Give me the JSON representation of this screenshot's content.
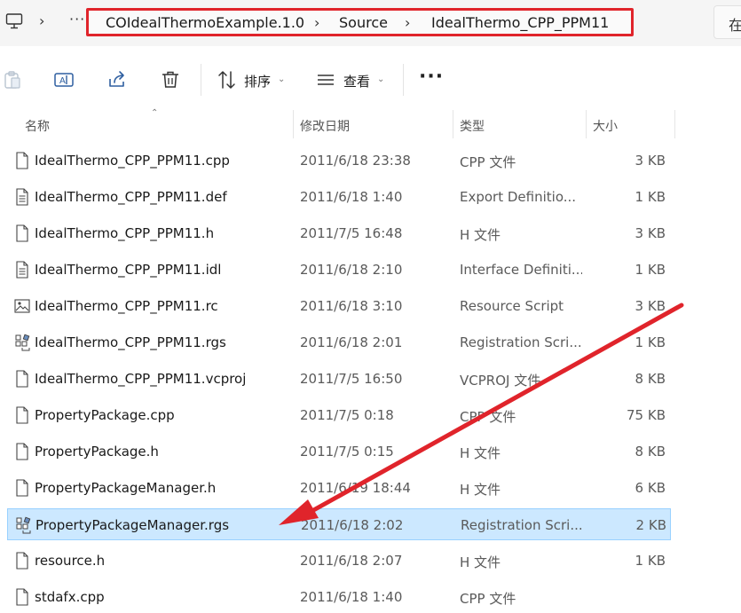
{
  "address": {
    "breadcrumbs": [
      "COIdealThermoExample.1.0",
      "Source",
      "IdealThermo_CPP_PPM11"
    ],
    "more": "···",
    "search_stub": "在"
  },
  "toolbar": {
    "sort_label": "排序",
    "view_label": "查看",
    "more": "···"
  },
  "columns": {
    "name": "名称",
    "date": "修改日期",
    "type": "类型",
    "size": "大小"
  },
  "files": [
    {
      "name": "IdealThermo_CPP_PPM11.cpp",
      "date": "2011/6/18 23:38",
      "type": "CPP 文件",
      "size": "3 KB",
      "icon": "file-icon"
    },
    {
      "name": "IdealThermo_CPP_PPM11.def",
      "date": "2011/6/18 1:40",
      "type": "Export Definitio...",
      "size": "1 KB",
      "icon": "text-file-icon"
    },
    {
      "name": "IdealThermo_CPP_PPM11.h",
      "date": "2011/7/5 16:48",
      "type": "H 文件",
      "size": "3 KB",
      "icon": "file-icon"
    },
    {
      "name": "IdealThermo_CPP_PPM11.idl",
      "date": "2011/6/18 2:10",
      "type": "Interface Definiti...",
      "size": "1 KB",
      "icon": "text-file-icon"
    },
    {
      "name": "IdealThermo_CPP_PPM11.rc",
      "date": "2011/6/18 3:10",
      "type": "Resource Script",
      "size": "3 KB",
      "icon": "image-file-icon"
    },
    {
      "name": "IdealThermo_CPP_PPM11.rgs",
      "date": "2011/6/18 2:01",
      "type": "Registration Scri...",
      "size": "1 KB",
      "icon": "registry-file-icon"
    },
    {
      "name": "IdealThermo_CPP_PPM11.vcproj",
      "date": "2011/7/5 16:50",
      "type": "VCPROJ 文件",
      "size": "8 KB",
      "icon": "file-icon"
    },
    {
      "name": "PropertyPackage.cpp",
      "date": "2011/7/5 0:18",
      "type": "CPP 文件",
      "size": "75 KB",
      "icon": "file-icon"
    },
    {
      "name": "PropertyPackage.h",
      "date": "2011/7/5 0:15",
      "type": "H 文件",
      "size": "8 KB",
      "icon": "file-icon"
    },
    {
      "name": "PropertyPackageManager.h",
      "date": "2011/6/19 18:44",
      "type": "H 文件",
      "size": "6 KB",
      "icon": "file-icon"
    },
    {
      "name": "PropertyPackageManager.rgs",
      "date": "2011/6/18 2:02",
      "type": "Registration Scri...",
      "size": "2 KB",
      "icon": "registry-file-icon",
      "selected": true
    },
    {
      "name": "resource.h",
      "date": "2011/6/18 2:07",
      "type": "H 文件",
      "size": "1 KB",
      "icon": "file-icon"
    },
    {
      "name": "stdafx.cpp",
      "date": "2011/6/18 1:40",
      "type": "CPP 文件",
      "size": "",
      "icon": "file-icon"
    }
  ],
  "colors": {
    "highlight_box": "#e0242b",
    "arrow": "#e0242b",
    "selection": "#cce8ff"
  }
}
